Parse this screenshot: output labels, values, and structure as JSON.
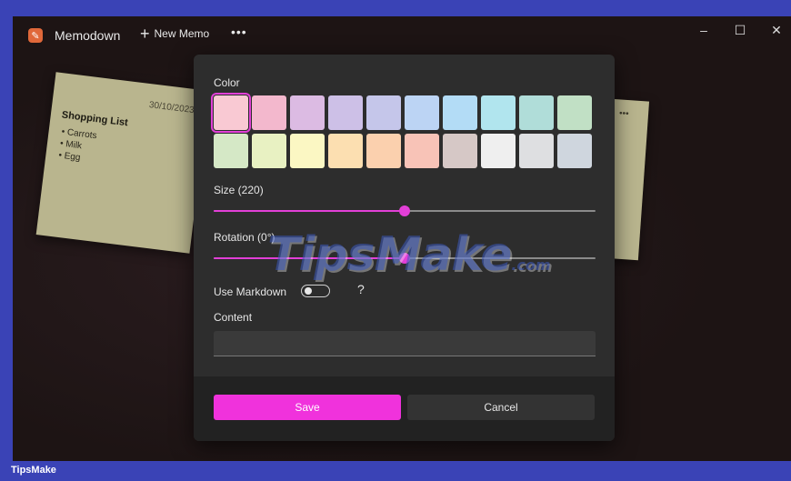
{
  "titlebar": {
    "app_title": "Memodown",
    "new_memo_label": "New Memo",
    "more_label": "•••",
    "window_controls": {
      "minimize": "–",
      "maximize": "☐",
      "close": "✕"
    }
  },
  "note_left": {
    "date": "30/10/2023",
    "title": "Shopping List",
    "items": [
      "Carrots",
      "Milk",
      "Egg"
    ]
  },
  "note_right": {
    "menu": "•••"
  },
  "dialog": {
    "color_label": "Color",
    "swatches": [
      "#f9c9d3",
      "#f3b8cd",
      "#dcbbe3",
      "#cdc0e7",
      "#c5c6ea",
      "#bcd4f4",
      "#b3dcf6",
      "#b1e5ee",
      "#b0ddd9",
      "#c1e0c5",
      "#d5e8c6",
      "#e8f1c2",
      "#fbf7c3",
      "#fcdfb1",
      "#fbd0ae",
      "#f8c3b7",
      "#d6c8c6",
      "#efefef",
      "#dedfe1",
      "#cfd6de"
    ],
    "selected_swatch": 0,
    "size_label": "Size (220)",
    "size_fraction": 0.5,
    "rotation_label": "Rotation (0°)",
    "rotation_fraction": 0.5,
    "markdown_label": "Use Markdown",
    "markdown_enabled": false,
    "help_symbol": "?",
    "content_label": "Content",
    "content_value": "",
    "save_label": "Save",
    "cancel_label": "Cancel"
  },
  "watermark": {
    "text": "TipsMake",
    "suffix": ".com"
  },
  "bottom_bar": {
    "label": "TipsMake"
  },
  "colors": {
    "accent": "#f032dc",
    "window_bg": "#1d1414",
    "dialog_bg": "#2d2d2d",
    "note_bg": "#b9b58e",
    "frame": "#3a43b6"
  }
}
